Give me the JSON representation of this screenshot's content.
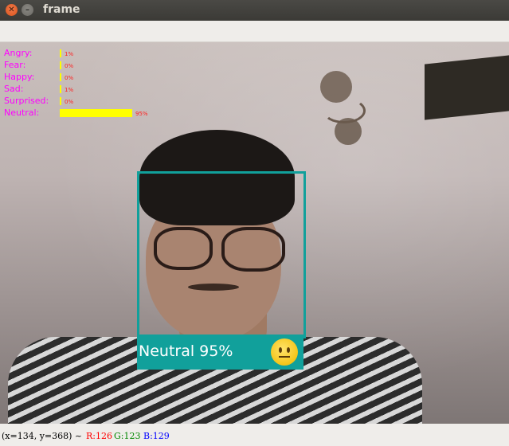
{
  "window": {
    "title": "frame"
  },
  "overlay": {
    "emotions": [
      {
        "label": "Angry:",
        "percent_text": "1%",
        "level": 0.01
      },
      {
        "label": "Fear:",
        "percent_text": "0%",
        "level": 0.0
      },
      {
        "label": "Happy:",
        "percent_text": "0%",
        "level": 0.0
      },
      {
        "label": "Sad:",
        "percent_text": "1%",
        "level": 0.01
      },
      {
        "label": "Surprised:",
        "percent_text": "0%",
        "level": 0.0
      },
      {
        "label": "Neutral:",
        "percent_text": "95%",
        "level": 0.95
      }
    ],
    "face_label": "Neutral 95%",
    "face_emoji": "neutral-face-emoji",
    "colors": {
      "label": "#ff00ff",
      "bar": "#ffff00",
      "percent": "#ff2020",
      "box": "#11a09b"
    }
  },
  "statusbar": {
    "coords": "(x=134, y=368) ~",
    "r": "R:126",
    "g": "G:123",
    "b": "B:129"
  }
}
